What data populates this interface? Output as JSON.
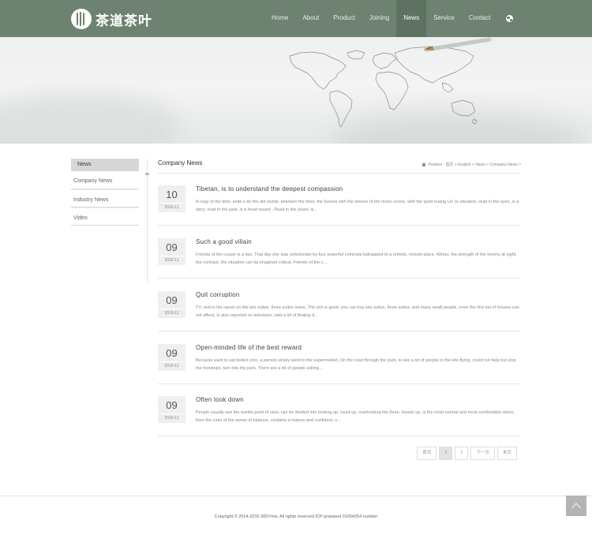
{
  "header": {
    "logo_text": "茶道茶叶",
    "nav": [
      "Home",
      "About",
      "Product",
      "Joining",
      "News",
      "Service",
      "Contact"
    ],
    "active_nav": "News",
    "lang_icon": "globe-icon"
  },
  "banner": {
    "illustration": "world-map-with-pen"
  },
  "sidebar": {
    "title": "News",
    "items": [
      "Company News",
      "Industry News",
      "Video"
    ]
  },
  "main": {
    "title": "Company News",
    "breadcrumb": "Position : 首页 > English > News > Company News >"
  },
  "articles": [
    {
      "day": "10",
      "ym": "2016-11",
      "title": "Tibetan, is to understand the deepest compassion",
      "excerpt": "A copy of the time, write a tie the old words, between the lines, the breeze with the breeze of the moon scene, with the quiet kuang Lei Ju situation, read in the eyes, is a story, read in the past, is a heart sound , Read in the years, is..."
    },
    {
      "day": "09",
      "ym": "2016-11",
      "title": "Such a good villain",
      "excerpt": "Friends of the cousin is a taxi, That day she was unfortunate by four powerful criminals kidnapped to a remote, remote place, Winter, the strength of the enemy at night, the contrast, the situation can be imagined critical, Friends of the c..."
    },
    {
      "day": "09",
      "ym": "2016-11",
      "title": "Quit corruption",
      "excerpt": "TV, and in the report on the two suites, three suites loans, The rich is good, you can buy two suites, three suites, and many small people, even the first set of houses can not afford, Is also reported on television, said a lot of Beijing d..."
    },
    {
      "day": "09",
      "ym": "2016-11",
      "title": "Open-minded life of the best reward",
      "excerpt": "Because want to eat boiled corn, a person slowly went to the supermarket, On the road through the park, to see a lot of people in the kite-flying, could not help but stop the footsteps, turn into the park, There are a lot of people selling..."
    },
    {
      "day": "09",
      "ym": "2016-11",
      "title": "Often look down",
      "excerpt": "People usually see the worlds point of view, can be divided into looking up, head-up, overlooking the three, Heads up, is the most normal and most comfortable vision, from the calm of the sense of balance, contains a mature and confident, n..."
    }
  ],
  "pagination": {
    "first": "首页",
    "pages": [
      "1",
      "2"
    ],
    "current": "1",
    "next": "下一页",
    "last": "末页"
  },
  "footer": {
    "copyright": "Copyright © 2014-2016 365Ymw, All rights reserved    ICP prepared 01054254 number"
  },
  "colors": {
    "header_bg": "#6d8270",
    "nav_active_bg": "#5e7262"
  }
}
